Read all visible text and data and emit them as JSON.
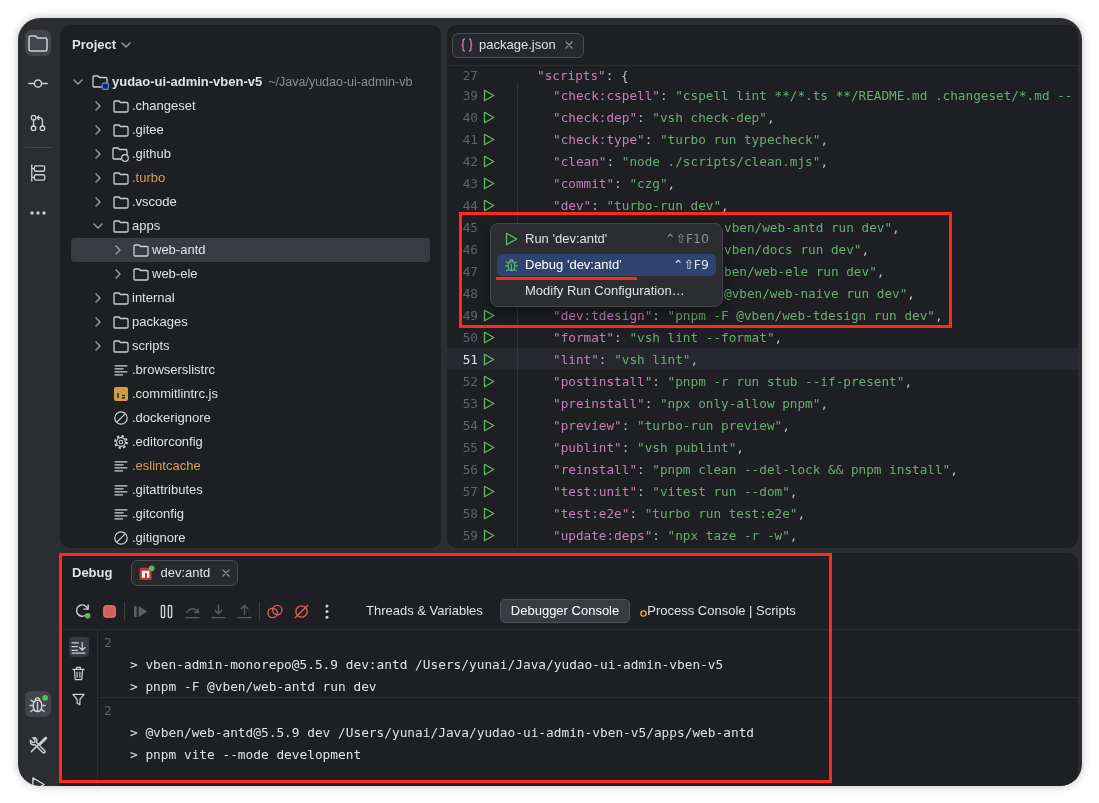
{
  "tool_strip": {
    "top": [
      {
        "kind": "project",
        "selected": true,
        "running": false
      },
      {
        "kind": "commit",
        "selected": false,
        "running": false
      },
      {
        "kind": "pullrequests",
        "selected": false,
        "running": false
      },
      {
        "kind": "structure",
        "selected": false,
        "running": false
      },
      {
        "kind": "more",
        "selected": false,
        "running": false
      }
    ],
    "bottom": [
      {
        "kind": "debug",
        "selected": true,
        "running": true
      },
      {
        "kind": "services",
        "selected": false,
        "running": false
      },
      {
        "kind": "run",
        "selected": false,
        "running": false
      }
    ]
  },
  "project": {
    "title": "Project",
    "tree": [
      {
        "kind": "module",
        "label": "yudao-ui-admin-vben-v5",
        "path": "~/Java/yudao-ui-admin-vb",
        "expanded": true,
        "selected": false,
        "ignored": false,
        "children": [
          {
            "kind": "folder",
            "label": ".changeset",
            "expanded": false,
            "selected": false,
            "ignored": false
          },
          {
            "kind": "folder",
            "label": ".gitee",
            "expanded": false,
            "selected": false,
            "ignored": false
          },
          {
            "kind": "gitfolder",
            "label": ".github",
            "expanded": false,
            "selected": false,
            "ignored": false
          },
          {
            "kind": "folder",
            "label": ".turbo",
            "expanded": false,
            "selected": false,
            "ignored": true
          },
          {
            "kind": "folder",
            "label": ".vscode",
            "expanded": false,
            "selected": false,
            "ignored": false
          },
          {
            "kind": "folder",
            "label": "apps",
            "expanded": true,
            "selected": false,
            "ignored": false,
            "children": [
              {
                "kind": "folder",
                "label": "web-antd",
                "expanded": false,
                "selected": true,
                "ignored": false
              },
              {
                "kind": "folder",
                "label": "web-ele",
                "expanded": false,
                "selected": false,
                "ignored": false
              }
            ]
          },
          {
            "kind": "folder",
            "label": "internal",
            "expanded": false,
            "selected": false,
            "ignored": false
          },
          {
            "kind": "folder",
            "label": "packages",
            "expanded": false,
            "selected": false,
            "ignored": false
          },
          {
            "kind": "folder",
            "label": "scripts",
            "expanded": false,
            "selected": false,
            "ignored": false
          },
          {
            "kind": "text",
            "label": ".browserslistrc",
            "selected": false,
            "ignored": false
          },
          {
            "kind": "js",
            "label": ".commitlintrc.js",
            "selected": false,
            "ignored": false
          },
          {
            "kind": "ignore",
            "label": ".dockerignore",
            "selected": false,
            "ignored": false
          },
          {
            "kind": "config",
            "label": ".editorconfig",
            "selected": false,
            "ignored": false
          },
          {
            "kind": "text",
            "label": ".eslintcache",
            "selected": false,
            "ignored": true
          },
          {
            "kind": "text",
            "label": ".gitattributes",
            "selected": false,
            "ignored": false
          },
          {
            "kind": "text",
            "label": ".gitconfig",
            "selected": false,
            "ignored": false
          },
          {
            "kind": "ignore",
            "label": ".gitignore",
            "selected": false,
            "ignored": false
          }
        ]
      }
    ]
  },
  "editor": {
    "tabs": [
      {
        "label": "package.json",
        "selected": true
      }
    ],
    "lines": [
      {
        "number": "27",
        "kind": "sticky",
        "text": "\"scripts\": {",
        "current": false,
        "marked": false
      },
      {
        "number": "39",
        "kind": "script",
        "text": "\"check:cspell\": \"cspell lint **/*.ts **/README.md .changeset/*.md --",
        "current": false,
        "marked": false
      },
      {
        "number": "40",
        "kind": "script",
        "text": "\"check:dep\": \"vsh check-dep\",",
        "current": false,
        "marked": false
      },
      {
        "number": "41",
        "kind": "script",
        "text": "\"check:type\": \"turbo run typecheck\",",
        "current": false,
        "marked": false
      },
      {
        "number": "42",
        "kind": "script",
        "text": "\"clean\": \"node ./scripts/clean.mjs\",",
        "current": false,
        "marked": false
      },
      {
        "number": "43",
        "kind": "script",
        "text": "\"commit\": \"czg\",",
        "current": false,
        "marked": false
      },
      {
        "number": "44",
        "kind": "script",
        "text": "\"dev\": \"turbo-run dev\",",
        "current": false,
        "marked": false
      },
      {
        "number": "45",
        "kind": "partial",
        "text": "vben/web-antd run dev\",",
        "current": false,
        "marked": true
      },
      {
        "number": "46",
        "kind": "partial",
        "text": "vben/docs run dev\",",
        "current": false,
        "marked": true
      },
      {
        "number": "47",
        "kind": "partial",
        "text": "ben/web-ele run dev\",",
        "current": false,
        "marked": true
      },
      {
        "number": "48",
        "kind": "partial",
        "text": "@vben/web-naive run dev\",",
        "current": false,
        "marked": true
      },
      {
        "number": "49",
        "kind": "script",
        "text": "\"dev:tdesign\": \"pnpm -F @vben/web-tdesign run dev\",",
        "current": false,
        "marked": true
      },
      {
        "number": "50",
        "kind": "script",
        "text": "\"format\": \"vsh lint --format\",",
        "current": false,
        "marked": false
      },
      {
        "number": "51",
        "kind": "script",
        "text": "\"lint\": \"vsh lint\",",
        "current": true,
        "marked": false
      },
      {
        "number": "52",
        "kind": "script",
        "text": "\"postinstall\": \"pnpm -r run stub --if-present\",",
        "current": false,
        "marked": false
      },
      {
        "number": "53",
        "kind": "script",
        "text": "\"preinstall\": \"npx only-allow pnpm\",",
        "current": false,
        "marked": false
      },
      {
        "number": "54",
        "kind": "script",
        "text": "\"preview\": \"turbo-run preview\",",
        "current": false,
        "marked": false
      },
      {
        "number": "55",
        "kind": "script",
        "text": "\"publint\": \"vsh publint\",",
        "current": false,
        "marked": false
      },
      {
        "number": "56",
        "kind": "script",
        "text": "\"reinstall\": \"pnpm clean --del-lock && pnpm install\",",
        "current": false,
        "marked": false
      },
      {
        "number": "57",
        "kind": "script",
        "text": "\"test:unit\": \"vitest run --dom\",",
        "current": false,
        "marked": false
      },
      {
        "number": "58",
        "kind": "script",
        "text": "\"test:e2e\": \"turbo run test:e2e\",",
        "current": false,
        "marked": false
      },
      {
        "number": "59",
        "kind": "script",
        "text": "\"update:deps\": \"npx taze -r -w\",",
        "current": false,
        "marked": false
      }
    ]
  },
  "context_menu": {
    "underlined": true,
    "items": [
      {
        "kind": "run",
        "label": "Run 'dev:antd'",
        "shortcut": "⌃⇧F10",
        "selected": false
      },
      {
        "kind": "debug",
        "label": "Debug 'dev:antd'",
        "shortcut": "⌃⇧F9",
        "selected": true
      },
      {
        "kind": "plain",
        "label": "Modify Run Configuration…",
        "selected": false
      }
    ]
  },
  "debug_panel": {
    "title": "Debug",
    "marked": true,
    "session_tabs": [
      {
        "label": "dev:antd",
        "selected": true,
        "running": true
      }
    ],
    "toolbar": [
      {
        "kind": "rerun",
        "disabled": false
      },
      {
        "kind": "stop",
        "disabled": false
      },
      {
        "kind": "resume",
        "disabled": true
      },
      {
        "kind": "pause",
        "disabled": false
      },
      {
        "kind": "stepover",
        "disabled": true
      },
      {
        "kind": "stepinto",
        "disabled": true
      },
      {
        "kind": "stepout",
        "disabled": true
      },
      {
        "kind": "breakpoints",
        "disabled": false
      },
      {
        "kind": "mute",
        "disabled": false
      },
      {
        "kind": "more",
        "disabled": false
      }
    ],
    "views": [
      {
        "kind": "plain",
        "label": "Threads & Variables",
        "selected": false
      },
      {
        "kind": "plain",
        "label": "Debugger Console",
        "selected": true
      },
      {
        "kind": "process",
        "label": "Process Console | Scripts",
        "selected": false
      }
    ],
    "console_tools": [
      {
        "kind": "scrollend",
        "selected": true
      },
      {
        "kind": "clear",
        "selected": false
      },
      {
        "kind": "filter",
        "selected": false
      }
    ],
    "console": [
      {
        "count": "2",
        "lines": [
          "> vben-admin-monorepo@5.5.9 dev:antd /Users/yunai/Java/yudao-ui-admin-vben-v5",
          "> pnpm -F @vben/web-antd run dev"
        ]
      },
      {
        "count": "2",
        "lines": [
          "> @vben/web-antd@5.5.9 dev /Users/yunai/Java/yudao-ui-admin-vben-v5/apps/web-antd",
          "> pnpm vite --mode development"
        ]
      }
    ]
  }
}
